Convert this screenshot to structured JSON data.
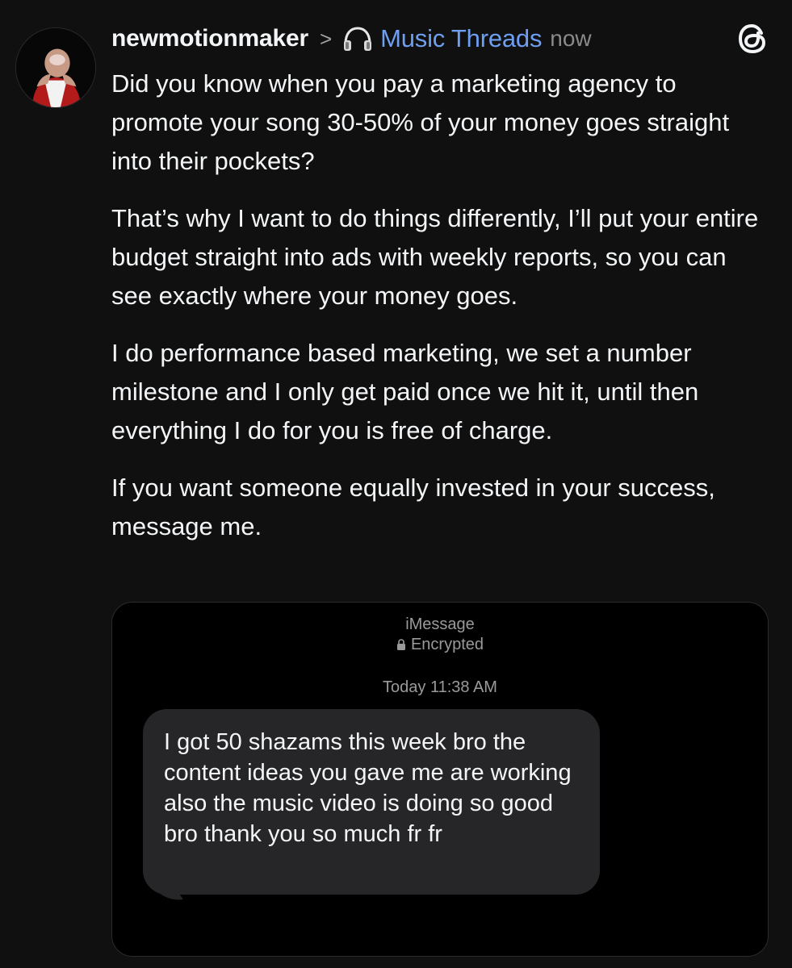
{
  "post": {
    "username": "newmotionmaker",
    "chevron": ">",
    "community_icon": "headphones-icon",
    "community": "Music Threads",
    "time": "now",
    "app_logo": "threads-logo-icon",
    "paragraphs": [
      "Did you know when you pay a marketing agency to promote your song 30-50% of your money goes straight into their pockets?",
      "That’s why I want to do things differently, I’ll put your entire budget straight into ads with weekly reports, so you can see exactly where your money goes.",
      "I do performance based marketing, we set a number milestone and I only get paid once we hit it, until then everything I do for you is free of charge.",
      "If you want someone equally invested in your success, message me."
    ]
  },
  "attachment": {
    "service": "iMessage",
    "encryption": "Encrypted",
    "timestamp": "Today 11:38 AM",
    "message": "I got 50 shazams this week bro the content ideas you gave me are working also the music video is doing so good bro thank you so much fr fr"
  },
  "colors": {
    "background": "#101010",
    "text": "#f3f5f7",
    "community_link": "#6e9ff1",
    "muted": "#8a8a8a",
    "bubble": "#262628"
  }
}
